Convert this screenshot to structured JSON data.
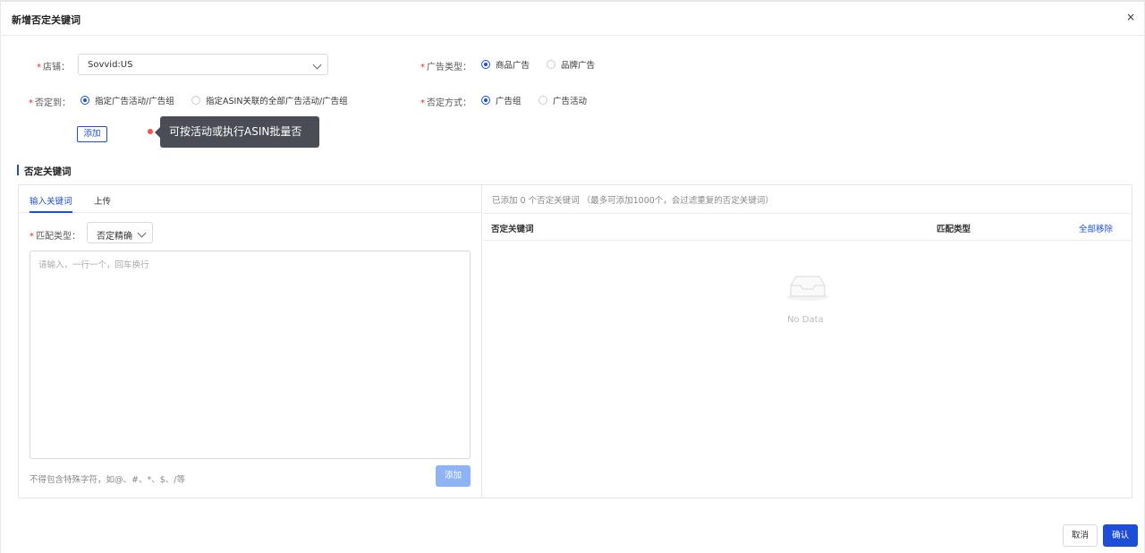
{
  "dialog": {
    "title": "新增否定关键词",
    "close": "×"
  },
  "form": {
    "store_label": "店铺：",
    "store_value": "Sovvid:US",
    "ad_type_label": "广告类型：",
    "ad_type_options": [
      "商品广告",
      "品牌广告"
    ],
    "ad_type_selected": "商品广告",
    "negate_to_label": "否定到：",
    "negate_to_options": [
      "指定广告活动/广告组",
      "指定ASIN关联的全部广告活动/广告组"
    ],
    "negate_to_selected": "指定广告活动/广告组",
    "negate_method_label": "否定方式：",
    "negate_method_options": [
      "广告组",
      "广告活动"
    ],
    "negate_method_selected": "广告组",
    "add_button": "添加",
    "tooltip": "可按活动或执行ASIN批量否"
  },
  "section": {
    "title": "否定关键词"
  },
  "left_panel": {
    "tabs": [
      "输入关键词",
      "上传"
    ],
    "active_tab": "输入关键词",
    "match_type_label": "匹配类型：",
    "match_type_value": "否定精确",
    "textarea_placeholder": "请输入，一行一个，回车换行",
    "hint": "不得包含特殊字符，如@、#、*、$、/等",
    "add_button": "添加"
  },
  "right_panel": {
    "count_text": "已添加 0 个否定关键词",
    "limit_note": "（最多可添加1000个，会过滤重复的否定关键词）",
    "columns": [
      "否定关键词",
      "匹配类型"
    ],
    "remove_all": "全部移除",
    "empty_text": "No Data"
  },
  "footer": {
    "cancel": "取消",
    "confirm": "确认"
  },
  "colors": {
    "primary": "#1d4ed8",
    "required": "#f5222d",
    "tooltip_bg": "#4a4d55"
  }
}
